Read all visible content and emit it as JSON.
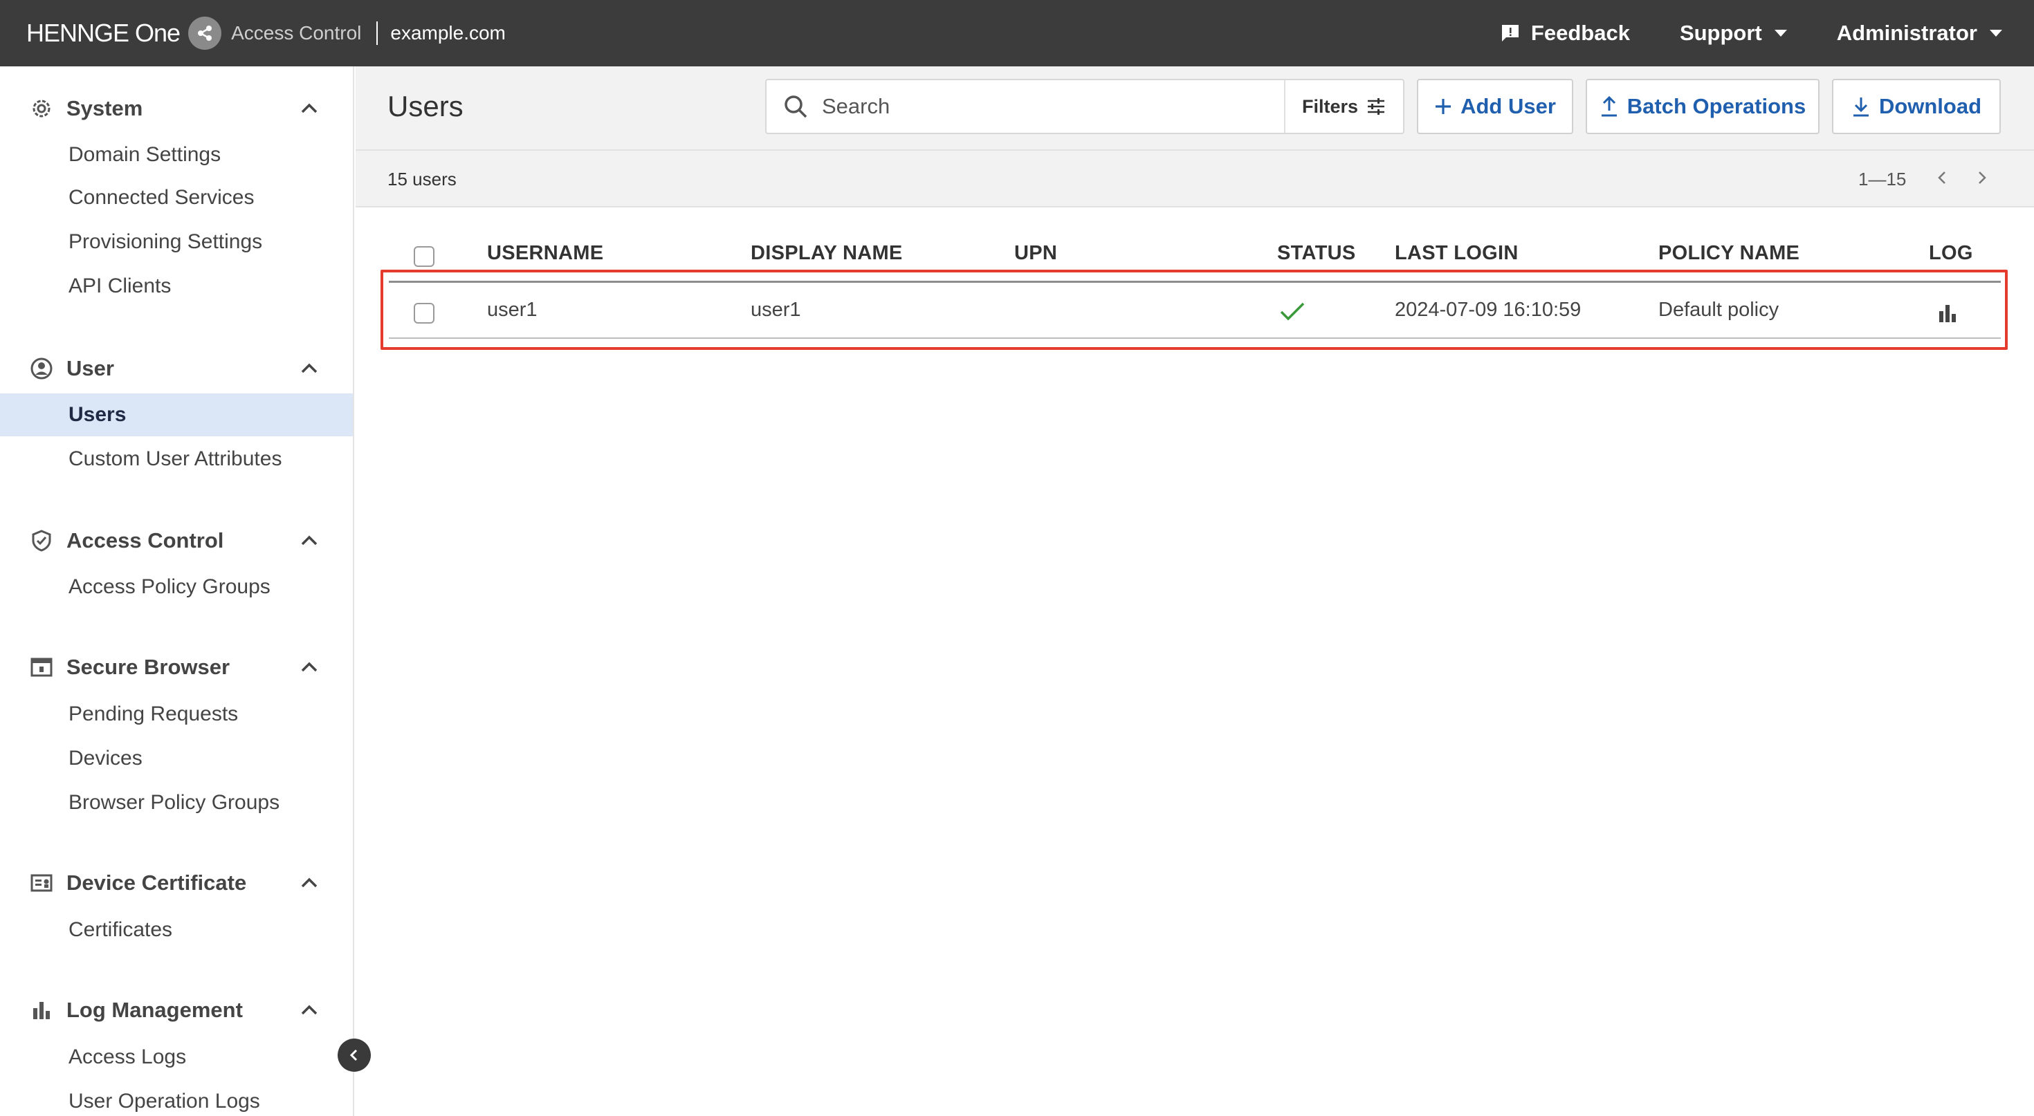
{
  "header": {
    "brand": "HENNGE One",
    "product": "Access Control",
    "domain": "example.com",
    "nav": {
      "feedback": "Feedback",
      "support": "Support",
      "account": "Administrator"
    }
  },
  "sidebar": {
    "sections": [
      {
        "title": "System",
        "icon": "gear-icon",
        "items": [
          "Domain Settings",
          "Connected Services",
          "Provisioning Settings",
          "API Clients"
        ]
      },
      {
        "title": "User",
        "icon": "user-circle-icon",
        "items": [
          "Users",
          "Custom User Attributes"
        ]
      },
      {
        "title": "Access Control",
        "icon": "shield-check-icon",
        "items": [
          "Access Policy Groups"
        ]
      },
      {
        "title": "Secure Browser",
        "icon": "browser-window-icon",
        "items": [
          "Pending Requests",
          "Devices",
          "Browser Policy Groups"
        ]
      },
      {
        "title": "Device Certificate",
        "icon": "certificate-icon",
        "items": [
          "Certificates"
        ]
      },
      {
        "title": "Log Management",
        "icon": "bar-chart-icon",
        "items": [
          "Access Logs",
          "User Operation Logs"
        ]
      }
    ],
    "active_item": "Users"
  },
  "main": {
    "title": "Users",
    "search": {
      "placeholder": "Search",
      "value": ""
    },
    "filters_label": "Filters",
    "actions": {
      "add_user": "Add User",
      "batch_operations": "Batch Operations",
      "download": "Download"
    },
    "count_label": "15 users",
    "range_label": "1—15"
  },
  "table": {
    "columns": [
      "USERNAME",
      "DISPLAY NAME",
      "UPN",
      "STATUS",
      "LAST LOGIN",
      "POLICY NAME",
      "LOG"
    ],
    "rows": [
      {
        "username": "user1",
        "display_name": "user1",
        "upn": "",
        "status": "active",
        "last_login": "2024-07-09 16:10:59",
        "policy_name": "Default policy"
      }
    ]
  },
  "colors": {
    "topbar": "#3c3c3c",
    "accent": "#1f5fae",
    "active_nav": "#dbe6f6",
    "status_ok": "#3a9a3a",
    "highlight": "#e53b2c"
  }
}
